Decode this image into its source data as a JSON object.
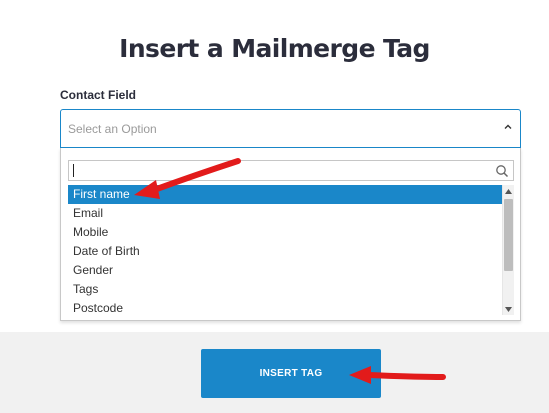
{
  "dialog": {
    "title": "Insert a Mailmerge Tag",
    "field_label": "Contact Field"
  },
  "select": {
    "placeholder": "Select an Option",
    "state": "open"
  },
  "dropdown": {
    "search_value": "",
    "options": [
      {
        "label": "First name",
        "highlighted": true
      },
      {
        "label": "Email",
        "highlighted": false
      },
      {
        "label": "Mobile",
        "highlighted": false
      },
      {
        "label": "Date of Birth",
        "highlighted": false
      },
      {
        "label": "Gender",
        "highlighted": false
      },
      {
        "label": "Tags",
        "highlighted": false
      },
      {
        "label": "Postcode",
        "highlighted": false
      }
    ]
  },
  "footer": {
    "insert_button_label": "INSERT TAG"
  },
  "icons": {
    "chevron": "chevron-up-icon",
    "search": "search-icon",
    "annotation_arrows": "red-arrow-icon"
  },
  "colors": {
    "accent": "#1a87c9",
    "title": "#2b2d3b",
    "footer_bg": "#f1f1f1",
    "annotation": "#e21b1b"
  }
}
